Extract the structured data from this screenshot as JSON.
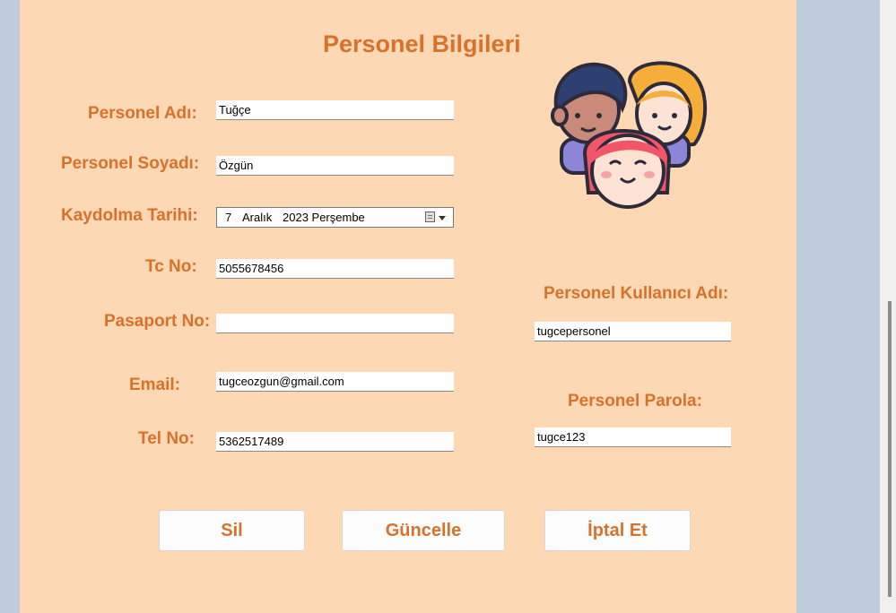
{
  "form": {
    "title": "Personel Bilgileri",
    "labels": {
      "ad": "Personel Adı:",
      "soyad": "Personel Soyadı:",
      "kayit_tarihi": "Kaydolma Tarihi:",
      "tc": "Tc No:",
      "pasaport": "Pasaport No:",
      "email": "Email:",
      "tel": "Tel No:",
      "kullanici_adi": "Personel Kullanıcı Adı:",
      "parola": "Personel Parola:"
    },
    "values": {
      "ad": "Tuğçe",
      "soyad": "Özgün",
      "tc": "5055678456",
      "pasaport": "",
      "email": "tugceozgun@gmail.com",
      "tel": "5362517489",
      "kullanici_adi": "tugcepersonel",
      "parola": "tugce123"
    },
    "date": {
      "day": "7",
      "month": "Aralık",
      "year_weekday": "2023 Perşembe"
    },
    "buttons": {
      "delete": "Sil",
      "update": "Güncelle",
      "cancel": "İptal Et"
    }
  },
  "colors": {
    "panel_background": "#fdd8b5",
    "accent_text": "#d7722b",
    "window_background": "#bfcddb"
  },
  "icons": {
    "date_picker": "calendar-icon",
    "illustration": "people-group-icon"
  }
}
